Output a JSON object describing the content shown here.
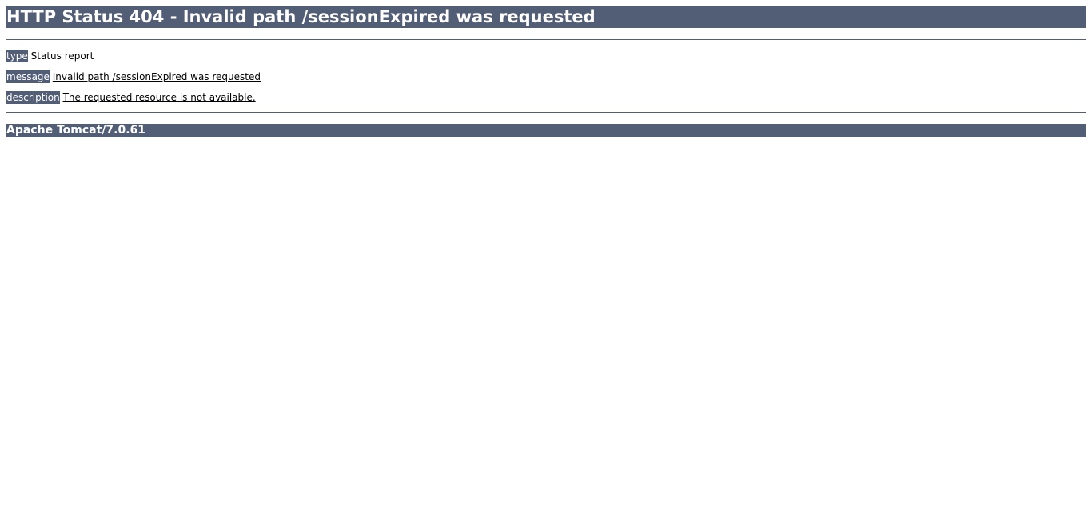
{
  "page": {
    "title": "HTTP Status 404 - Invalid path /sessionExpired was requested"
  },
  "details": {
    "type_label": "type",
    "type_value": "Status report",
    "message_label": "message",
    "message_value": "Invalid path /sessionExpired was requested",
    "description_label": "description",
    "description_value": "The requested resource is not available."
  },
  "footer": {
    "server": "Apache Tomcat/7.0.61"
  },
  "colors": {
    "bar_background": "#525d76",
    "bar_text": "#ffffff",
    "page_background": "#ffffff"
  }
}
